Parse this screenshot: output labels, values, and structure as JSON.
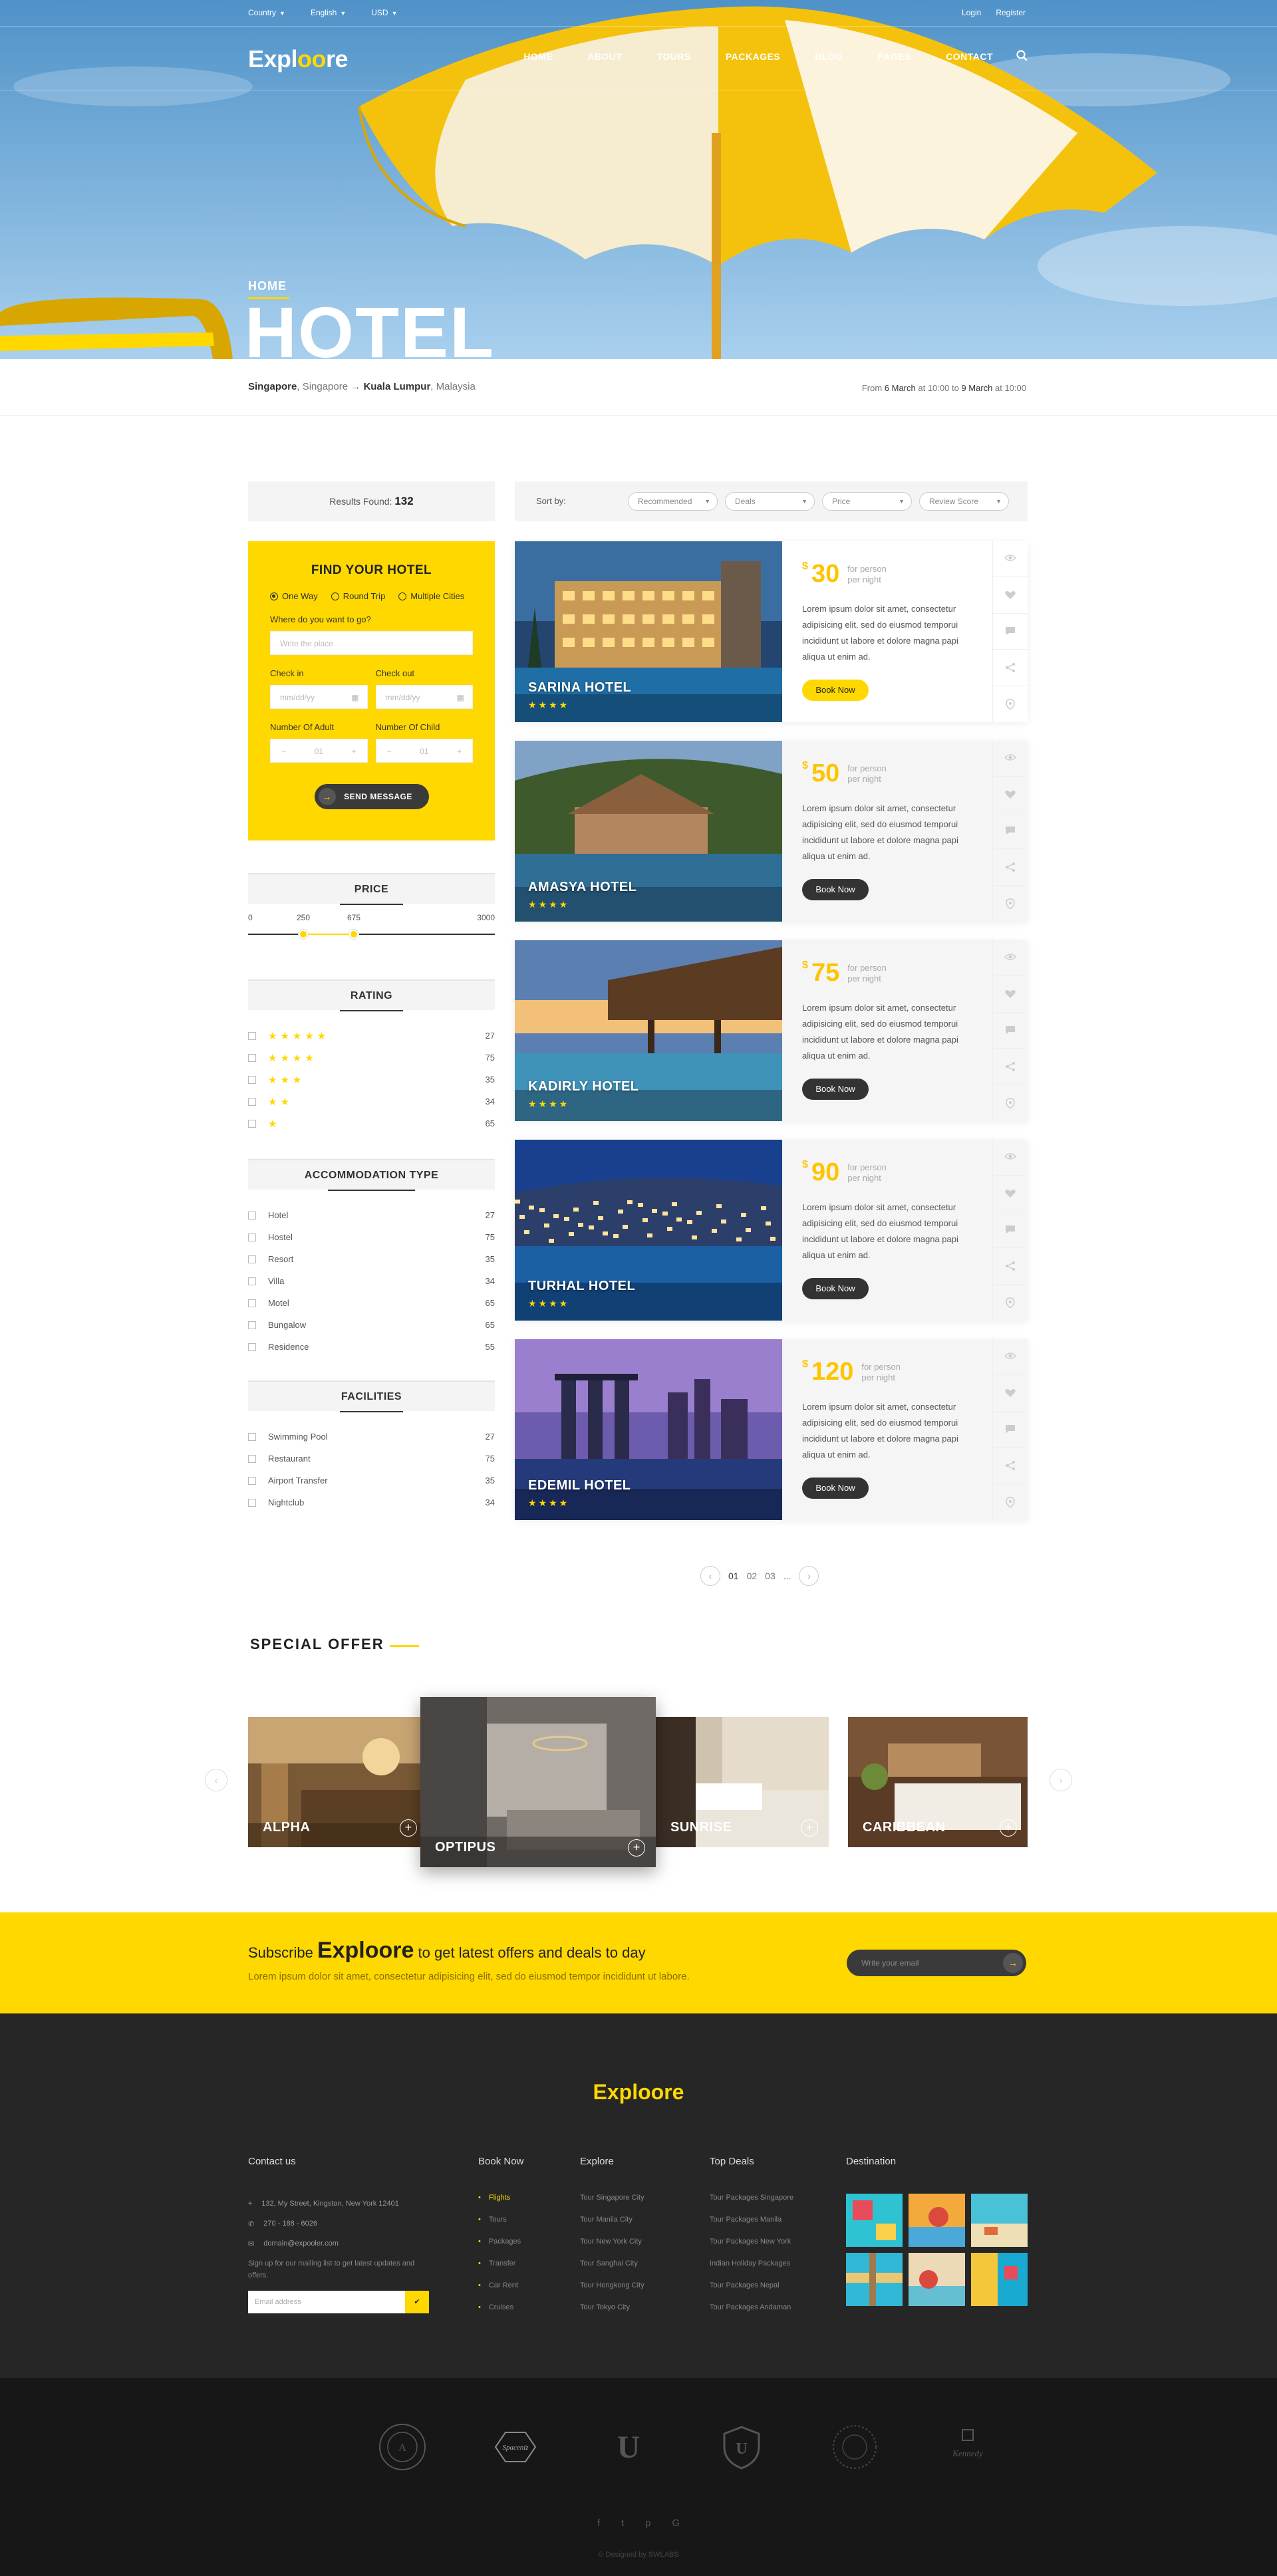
{
  "topbar": {
    "country": "Country",
    "language": "English",
    "currency": "USD",
    "login": "Login",
    "register": "Register"
  },
  "nav": {
    "logo_a": "Expl",
    "logo_b": "oo",
    "logo_c": "re",
    "items": [
      "HOME",
      "ABOUT",
      "TOURS",
      "PACKAGES",
      "BLOG",
      "PAGES",
      "CONTACT"
    ]
  },
  "hero": {
    "breadcrumb": "HOME",
    "title": "HOTEL"
  },
  "route": {
    "from_city": "Singapore",
    "from_country": ", Singapore",
    "arrow": " → ",
    "to_city": "Kuala Lumpur",
    "to_country": ", Malaysia",
    "date_from_prefix": "From ",
    "date_from": "6 March",
    "date_mid": " at 10:00 to ",
    "date_to": "9 March",
    "date_suffix": " at 10:00"
  },
  "results": {
    "label": "Results Found: ",
    "count": "132"
  },
  "sort": {
    "label": "Sort by:",
    "options": [
      "Recommended",
      "Deals",
      "Price",
      "Review Score"
    ]
  },
  "find": {
    "title": "FIND YOUR HOTEL",
    "trip_types": [
      "One Way",
      "Round Trip",
      "Multiple Cities"
    ],
    "where_label": "Where do you want to go?",
    "where_placeholder": "Write the place",
    "checkin_label": "Check in",
    "checkout_label": "Check out",
    "date_placeholder": "mm/dd/yy",
    "adult_label": "Number Of Adult",
    "child_label": "Number Of Child",
    "adult_value": "01",
    "child_value": "01",
    "minus": "−",
    "plus": "+",
    "send": "SEND MESSAGE"
  },
  "price_filter": {
    "title": "PRICE",
    "min": "0",
    "low": "250",
    "high": "675",
    "max": "3000"
  },
  "rating_filter": {
    "title": "RATING",
    "items": [
      {
        "stars": "★★★★★",
        "count": "27"
      },
      {
        "stars": "★★★★",
        "count": "75"
      },
      {
        "stars": "★★★",
        "count": "35"
      },
      {
        "stars": "★★",
        "count": "34"
      },
      {
        "stars": "★",
        "count": "65"
      }
    ]
  },
  "accommodation": {
    "title": "ACCOMMODATION TYPE",
    "items": [
      {
        "label": "Hotel",
        "count": "27"
      },
      {
        "label": "Hostel",
        "count": "75"
      },
      {
        "label": "Resort",
        "count": "35"
      },
      {
        "label": "Villa",
        "count": "34"
      },
      {
        "label": "Motel",
        "count": "65"
      },
      {
        "label": "Bungalow",
        "count": "65"
      },
      {
        "label": "Residence",
        "count": "55"
      }
    ]
  },
  "facilities": {
    "title": "FACILITIES",
    "items": [
      {
        "label": "Swimming Pool",
        "count": "27"
      },
      {
        "label": "Restaurant",
        "count": "75"
      },
      {
        "label": "Airport Transfer",
        "count": "35"
      },
      {
        "label": "Nightclub",
        "count": "34"
      }
    ]
  },
  "hotels": [
    {
      "name": "SARINA HOTEL",
      "stars": "★★★★",
      "currency": "$",
      "price": "30",
      "per_a": "for person",
      "per_b": "per night",
      "desc": "Lorem ipsum dolor sit amet, consectetur adipisicing elit, sed do eiusmod temporui incididunt ut labore et dolore magna papi aliqua ut enim ad.",
      "book": "Book Now"
    },
    {
      "name": "AMASYA HOTEL",
      "stars": "★★★★",
      "currency": "$",
      "price": "50",
      "per_a": "for person",
      "per_b": "per night",
      "desc": "Lorem ipsum dolor sit amet, consectetur adipisicing elit, sed do eiusmod temporui incididunt ut labore et dolore magna papi aliqua ut enim ad.",
      "book": "Book Now"
    },
    {
      "name": "KADIRLY HOTEL",
      "stars": "★★★★",
      "currency": "$",
      "price": "75",
      "per_a": "for person",
      "per_b": "per night",
      "desc": "Lorem ipsum dolor sit amet, consectetur adipisicing elit, sed do eiusmod temporui incididunt ut labore et dolore magna papi aliqua ut enim ad.",
      "book": "Book Now"
    },
    {
      "name": "TURHAL HOTEL",
      "stars": "★★★★",
      "currency": "$",
      "price": "90",
      "per_a": "for person",
      "per_b": "per night",
      "desc": "Lorem ipsum dolor sit amet, consectetur adipisicing elit, sed do eiusmod temporui incididunt ut labore et dolore magna papi aliqua ut enim ad.",
      "book": "Book Now"
    },
    {
      "name": "EDEMIL HOTEL",
      "stars": "★★★★",
      "currency": "$",
      "price": "120",
      "per_a": "for person",
      "per_b": "per night",
      "desc": "Lorem ipsum dolor sit amet, consectetur adipisicing elit, sed do eiusmod temporui incididunt ut labore et dolore magna papi aliqua ut enim ad.",
      "book": "Book Now"
    }
  ],
  "pagination": {
    "prev": "‹",
    "pages": [
      "01",
      "02",
      "03",
      "..."
    ],
    "next": "›"
  },
  "special_offer": {
    "title": "SPECIAL OFFER",
    "prev": "‹",
    "next": "›",
    "plus": "+",
    "items": [
      "ALPHA",
      "OPTIPUS",
      "SUNRISE",
      "CARIBBEAN"
    ]
  },
  "subscribe": {
    "pre": "Subscribe ",
    "brand": "Exploore",
    "post": " to get latest offers and deals to day",
    "text": "Lorem ipsum dolor sit amet, consectetur adipisicing elit, sed do eiusmod tempor incididunt ut labore.",
    "placeholder": "Write your email",
    "go": "→"
  },
  "footer": {
    "logo": "Exploore",
    "contact_title": "Contact us",
    "address": "132, My Street, Kingston, New York 12401",
    "phone": "270 - 188 - 6026",
    "email": "domain@expooler.com",
    "signup": "Sign up for our mailing list to get latest updates and offers.",
    "email_placeholder": "Email address",
    "ok": "✔",
    "book_title": "Book Now",
    "book_items": [
      "Flights",
      "Tours",
      "Packages",
      "Transfer",
      "Car Rent",
      "Cruises"
    ],
    "explore_title": "Explore",
    "explore_items": [
      "Tour  Singapore City",
      "Tour  Manila City",
      "Tour  New York City",
      "Tour  Sanghai City",
      "Tour  Hongkong City",
      "Tour  Tokyo City"
    ],
    "deals_title": "Top Deals",
    "deals_items": [
      "Tour Packages Singapore",
      "Tour Packages Manila",
      "Tour Packages New York",
      "Indian Holiday Packages",
      "Tour Packages Nepal",
      "Tour Packages Andaman"
    ],
    "dest_title": "Destination"
  },
  "bottom": {
    "badges": [
      "",
      "Spaceniz",
      "U",
      "U",
      "",
      "Kennedy"
    ],
    "social": [
      "f",
      "t",
      "p",
      "G"
    ],
    "copyright": "© Designed by SWLABS"
  },
  "colors": {
    "accent": "#ffd800",
    "dark": "#262626",
    "darker": "#171717"
  }
}
